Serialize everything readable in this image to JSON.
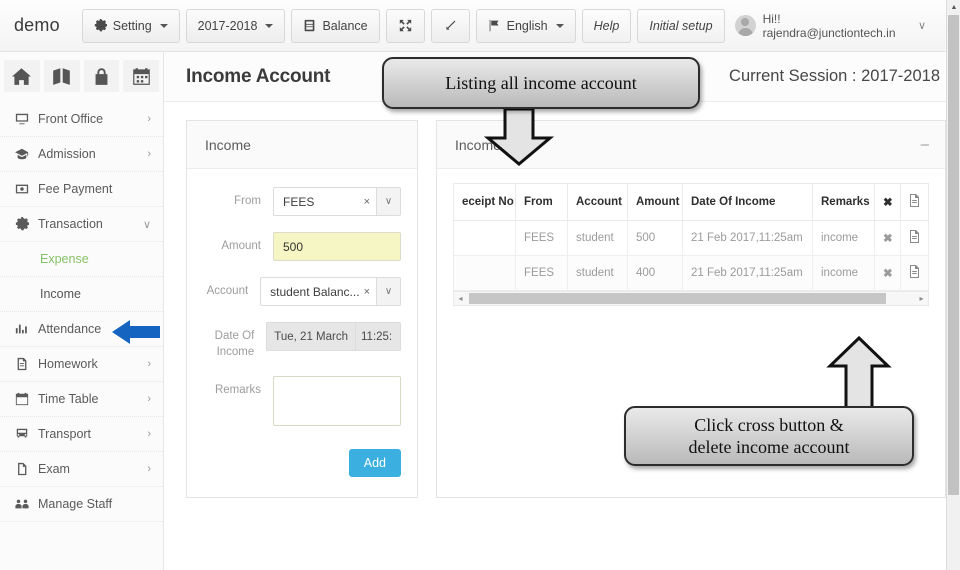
{
  "topbar": {
    "brand": "demo",
    "buttons": [
      {
        "label": "Setting",
        "icon": "gear-icon",
        "caret": true
      },
      {
        "label": "2017-2018",
        "icon": null,
        "caret": true
      },
      {
        "label": "Balance",
        "icon": "database-icon",
        "caret": false
      },
      {
        "label": "",
        "icon": "expand-arrows-icon",
        "caret": false
      },
      {
        "label": "",
        "icon": "resize-diagonal-icon",
        "caret": false
      },
      {
        "label": "English",
        "icon": "flag-icon",
        "caret": true
      },
      {
        "label": "Help",
        "icon": null,
        "caret": false
      },
      {
        "label": "Initial setup",
        "icon": null,
        "caret": false
      }
    ],
    "user": {
      "greeting": "Hi!! rajendra@junctiontech.in",
      "caret": "∨"
    }
  },
  "sidebar": {
    "quick_icons": [
      "home-icon",
      "translate-icon",
      "lock-icon",
      "calendar-icon"
    ],
    "items": [
      {
        "label": "Front Office",
        "icon": "monitor-icon",
        "arrow": "›"
      },
      {
        "label": "Admission",
        "icon": "graduation-cap-icon",
        "arrow": "›"
      },
      {
        "label": "Fee Payment",
        "icon": "money-icon",
        "arrow": ""
      },
      {
        "label": "Transaction",
        "icon": "gear-icon",
        "arrow": "∨"
      }
    ],
    "sub_items": [
      {
        "label": "Expense",
        "state": "active-green"
      },
      {
        "label": "Income",
        "state": "selected"
      }
    ],
    "items_after": [
      {
        "label": "Attendance",
        "icon": "chart-bar-icon",
        "arrow": "›"
      },
      {
        "label": "Homework",
        "icon": "file-text-icon",
        "arrow": "›"
      },
      {
        "label": "Time Table",
        "icon": "calendar-icon",
        "arrow": "›"
      },
      {
        "label": "Transport",
        "icon": "bus-icon",
        "arrow": "›"
      },
      {
        "label": "Exam",
        "icon": "document-icon",
        "arrow": "›"
      },
      {
        "label": "Manage Staff",
        "icon": "users-icon",
        "arrow": ""
      }
    ]
  },
  "page": {
    "title": "Income Account",
    "session": "Current Session : 2017-2018"
  },
  "income_form": {
    "title": "Income",
    "fields": {
      "from_label": "From",
      "from_value": "FEES",
      "amount_label": "Amount",
      "amount_value": "500",
      "account_label": "Account",
      "account_value": "student Balanc...",
      "date_label": "Date Of Income",
      "date_value": "Tue, 21 March",
      "time_value": "11:25:",
      "remarks_label": "Remarks",
      "remarks_value": "",
      "clear_mark": "×",
      "dropdown_caret": "∨"
    },
    "add_button": "Add"
  },
  "income_list": {
    "title": "Income List",
    "minimize": "–",
    "columns": [
      "eceipt No",
      "From",
      "Account",
      "Amount",
      "Date Of Income",
      "Remarks",
      "✖",
      "doc-icon"
    ],
    "rows": [
      {
        "receipt_no": "",
        "from": "FEES",
        "account": "student",
        "amount": "500",
        "date": "21 Feb 2017,11:25am",
        "remarks": "income",
        "delete": "✖",
        "doc": "doc-icon"
      },
      {
        "receipt_no": "",
        "from": "FEES",
        "account": "student",
        "amount": "400",
        "date": "21 Feb 2017,11:25am",
        "remarks": "income",
        "delete": "✖",
        "doc": "doc-icon"
      }
    ],
    "scroll_left": "◂",
    "scroll_right": "▸"
  },
  "callouts": [
    {
      "id": "callout-1",
      "text": "Listing all income account",
      "arrow": "down"
    },
    {
      "id": "callout-2",
      "text": "Click cross button &\ndelete income account",
      "arrow": "up"
    }
  ],
  "colors": {
    "accent_blue": "#3bb0e0",
    "pointer_blue": "#1565c0",
    "amount_highlight": "#f6f6c4",
    "expense_green": "#86c167"
  }
}
